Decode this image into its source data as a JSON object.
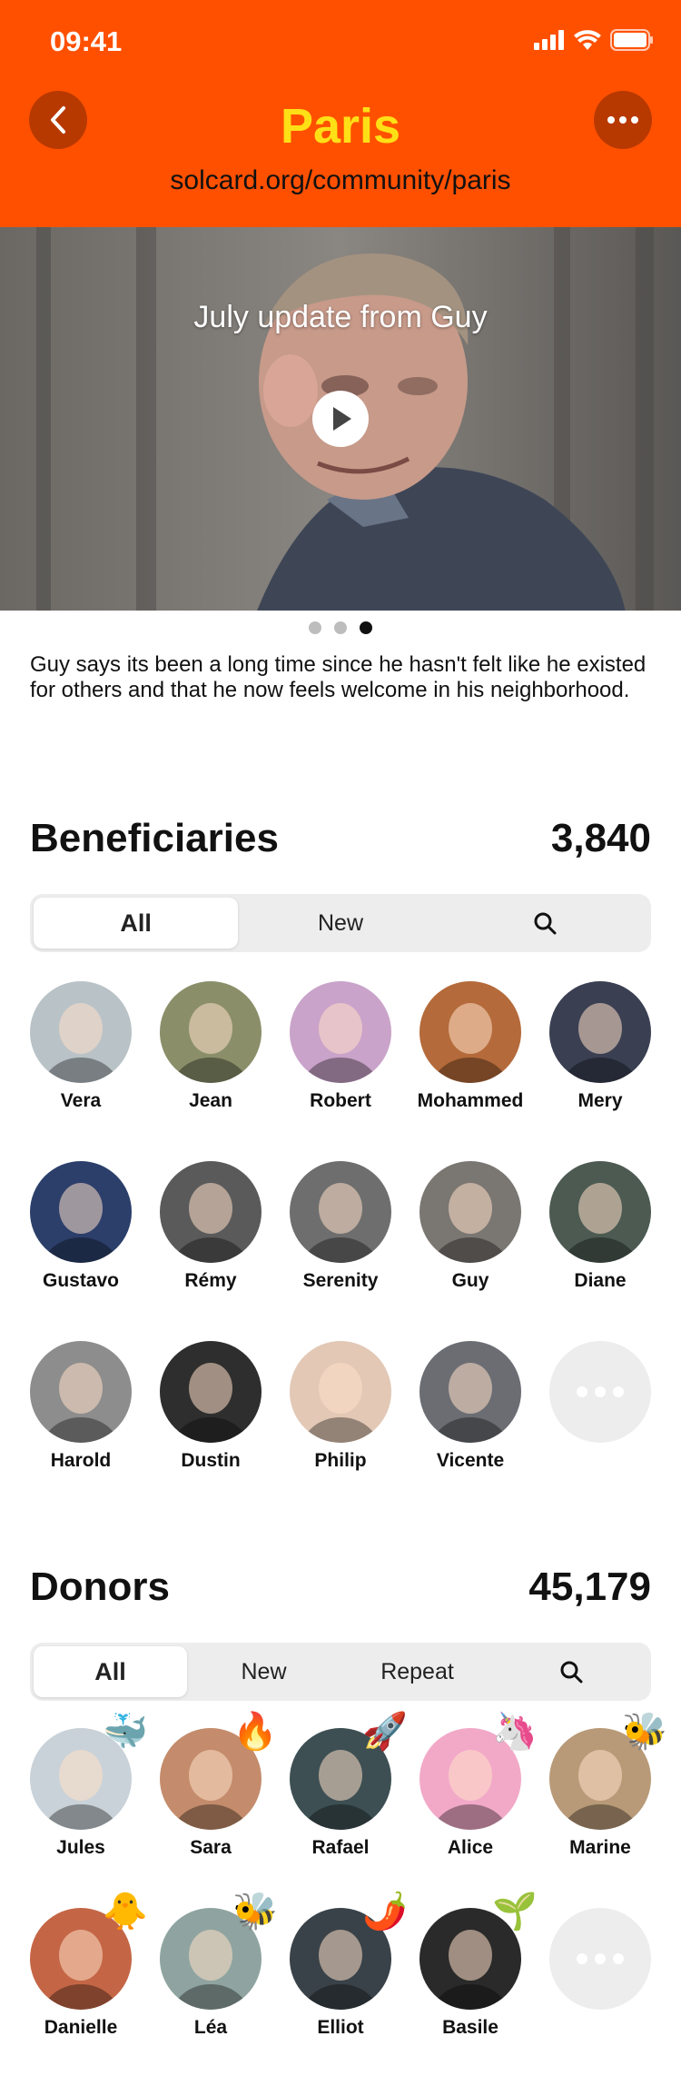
{
  "status": {
    "time": "09:41"
  },
  "header": {
    "title": "Paris",
    "url": "solcard.org/community/paris",
    "back_icon": "chevron-left-icon",
    "more_icon": "ellipsis-icon"
  },
  "hero": {
    "caption": "July update from Guy",
    "story": "Guy says its been a long time since he hasn't felt like he existed for others and that he now feels welcome in his neighborhood.",
    "pages": 3,
    "active_page": 3
  },
  "beneficiaries": {
    "title": "Beneficiaries",
    "count": "3,840",
    "tabs": [
      "All",
      "New",
      "search-icon"
    ],
    "people": [
      {
        "name": "Vera",
        "color": "#b9c2c7"
      },
      {
        "name": "Jean",
        "color": "#8a8f6a"
      },
      {
        "name": "Robert",
        "color": "#c9a3c9"
      },
      {
        "name": "Mohammed",
        "color": "#b46a3a"
      },
      {
        "name": "Mery",
        "color": "#3a3f52"
      },
      {
        "name": "Gustavo",
        "color": "#2c3f6b"
      },
      {
        "name": "Rémy",
        "color": "#5a5a5a"
      },
      {
        "name": "Serenity",
        "color": "#6e6e6e"
      },
      {
        "name": "Guy",
        "color": "#7a7672"
      },
      {
        "name": "Diane",
        "color": "#4c5a52"
      },
      {
        "name": "Harold",
        "color": "#8d8d8d"
      },
      {
        "name": "Dustin",
        "color": "#2e2e2e"
      },
      {
        "name": "Philip",
        "color": "#e2c8b5"
      },
      {
        "name": "Vicente",
        "color": "#6b6d73"
      }
    ]
  },
  "donors": {
    "title": "Donors",
    "count": "45,179",
    "tabs": [
      "All",
      "New",
      "Repeat",
      "search-icon"
    ],
    "people": [
      {
        "name": "Jules",
        "color": "#c9d2d8",
        "badge": "🐳"
      },
      {
        "name": "Sara",
        "color": "#c48c6c",
        "badge": "🔥"
      },
      {
        "name": "Rafael",
        "color": "#3d4f52",
        "badge": "🚀"
      },
      {
        "name": "Alice",
        "color": "#f2a9c8",
        "badge": "🦄"
      },
      {
        "name": "Marine",
        "color": "#b89a78",
        "badge": "🐝"
      },
      {
        "name": "Danielle",
        "color": "#c46646",
        "badge": "🐥"
      },
      {
        "name": "Léa",
        "color": "#8fa4a0",
        "badge": "🐝"
      },
      {
        "name": "Elliot",
        "color": "#394248",
        "badge": "🌶️"
      },
      {
        "name": "Basile",
        "color": "#2a2a2a",
        "badge": "🌱"
      }
    ]
  }
}
